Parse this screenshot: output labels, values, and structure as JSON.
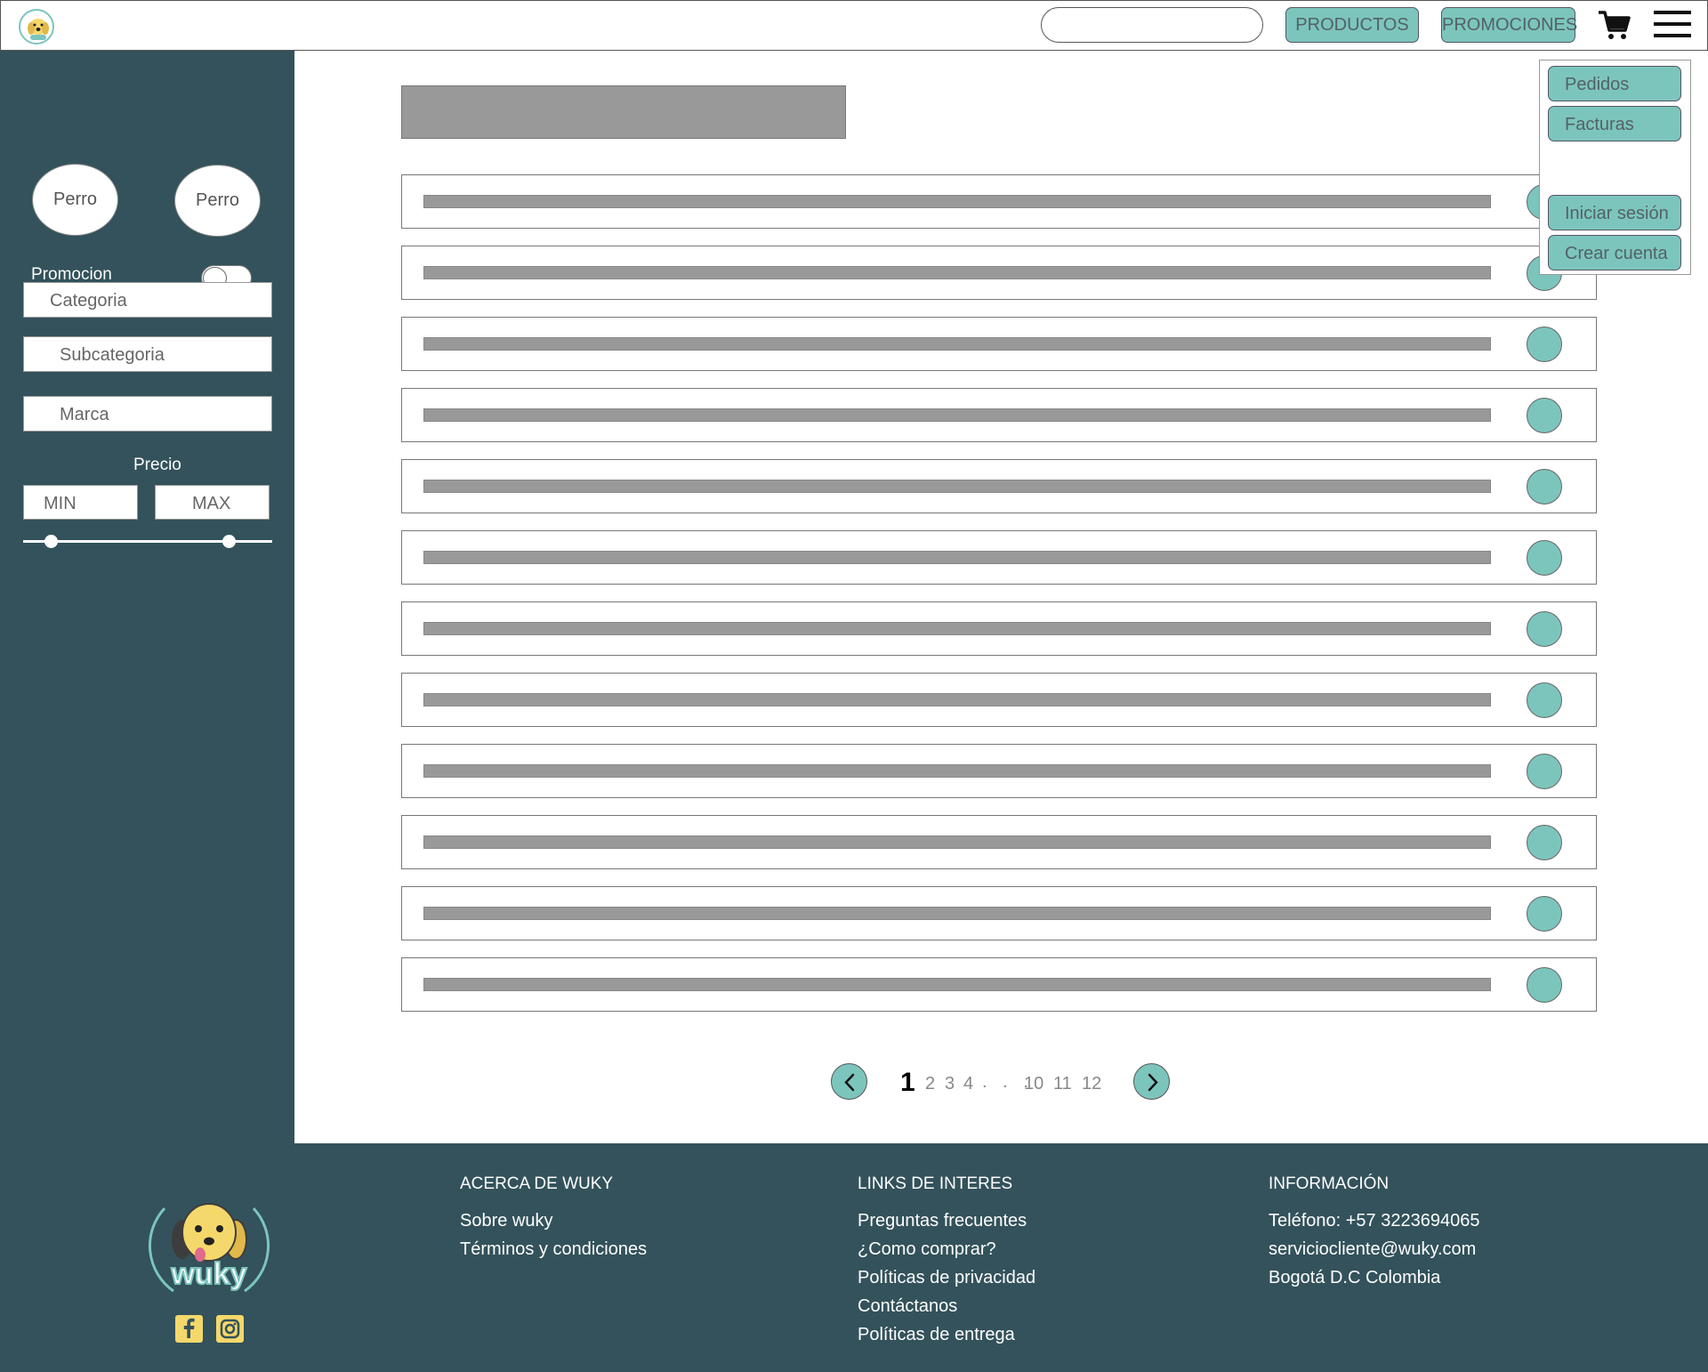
{
  "header": {
    "search_placeholder": "",
    "productos_label": "PRODUCTOS",
    "promociones_label": "PROMOCIONES",
    "cart_icon": "cart-icon",
    "menu_icon": "hamburger-menu-icon"
  },
  "sidebar": {
    "pet_filters": [
      "Perro",
      "Perro"
    ],
    "promocion_label": "Promocion",
    "promocion_enabled": false,
    "categoria_label": "Categoria",
    "subcategoria_label": "Subcategoria",
    "marca_label": "Marca",
    "precio_label": "Precio",
    "min_label": "MIN",
    "max_label": "MAX",
    "price_range": [
      0.1,
      0.86
    ]
  },
  "main": {
    "row_count": 12
  },
  "pagination": {
    "current": "1",
    "pages": [
      "2",
      "3",
      "4"
    ],
    "dots": ". . .",
    "last_pages": [
      "10",
      "11",
      "12"
    ],
    "prev_icon": "chevron-left-icon",
    "next_icon": "chevron-right-icon"
  },
  "user_menu": {
    "pedidos": "Pedidos",
    "facturas": "Facturas",
    "iniciar_sesion": "Iniciar sesión",
    "crear_cuenta": "Crear cuenta"
  },
  "footer": {
    "brand": "wuky",
    "acerca": {
      "heading": "ACERCA DE WUKY",
      "links": [
        "Sobre wuky",
        "Términos y condiciones"
      ]
    },
    "links_interes": {
      "heading": "LINKS DE INTERES",
      "links": [
        "Preguntas frecuentes",
        "¿Como comprar?",
        "Políticas de privacidad",
        "Contáctanos",
        "Políticas de entrega"
      ]
    },
    "informacion": {
      "heading": "INFORMACIÓN",
      "lines": [
        "Teléfono: +57 3223694065",
        "serviciocliente@wuky.com",
        "Bogotá D.C Colombia"
      ]
    },
    "social_icons": [
      "facebook-icon",
      "instagram-icon"
    ]
  },
  "colors": {
    "dark_teal": "#33525b",
    "accent_teal": "#7cc5bd",
    "placeholder_gray": "#999999"
  }
}
